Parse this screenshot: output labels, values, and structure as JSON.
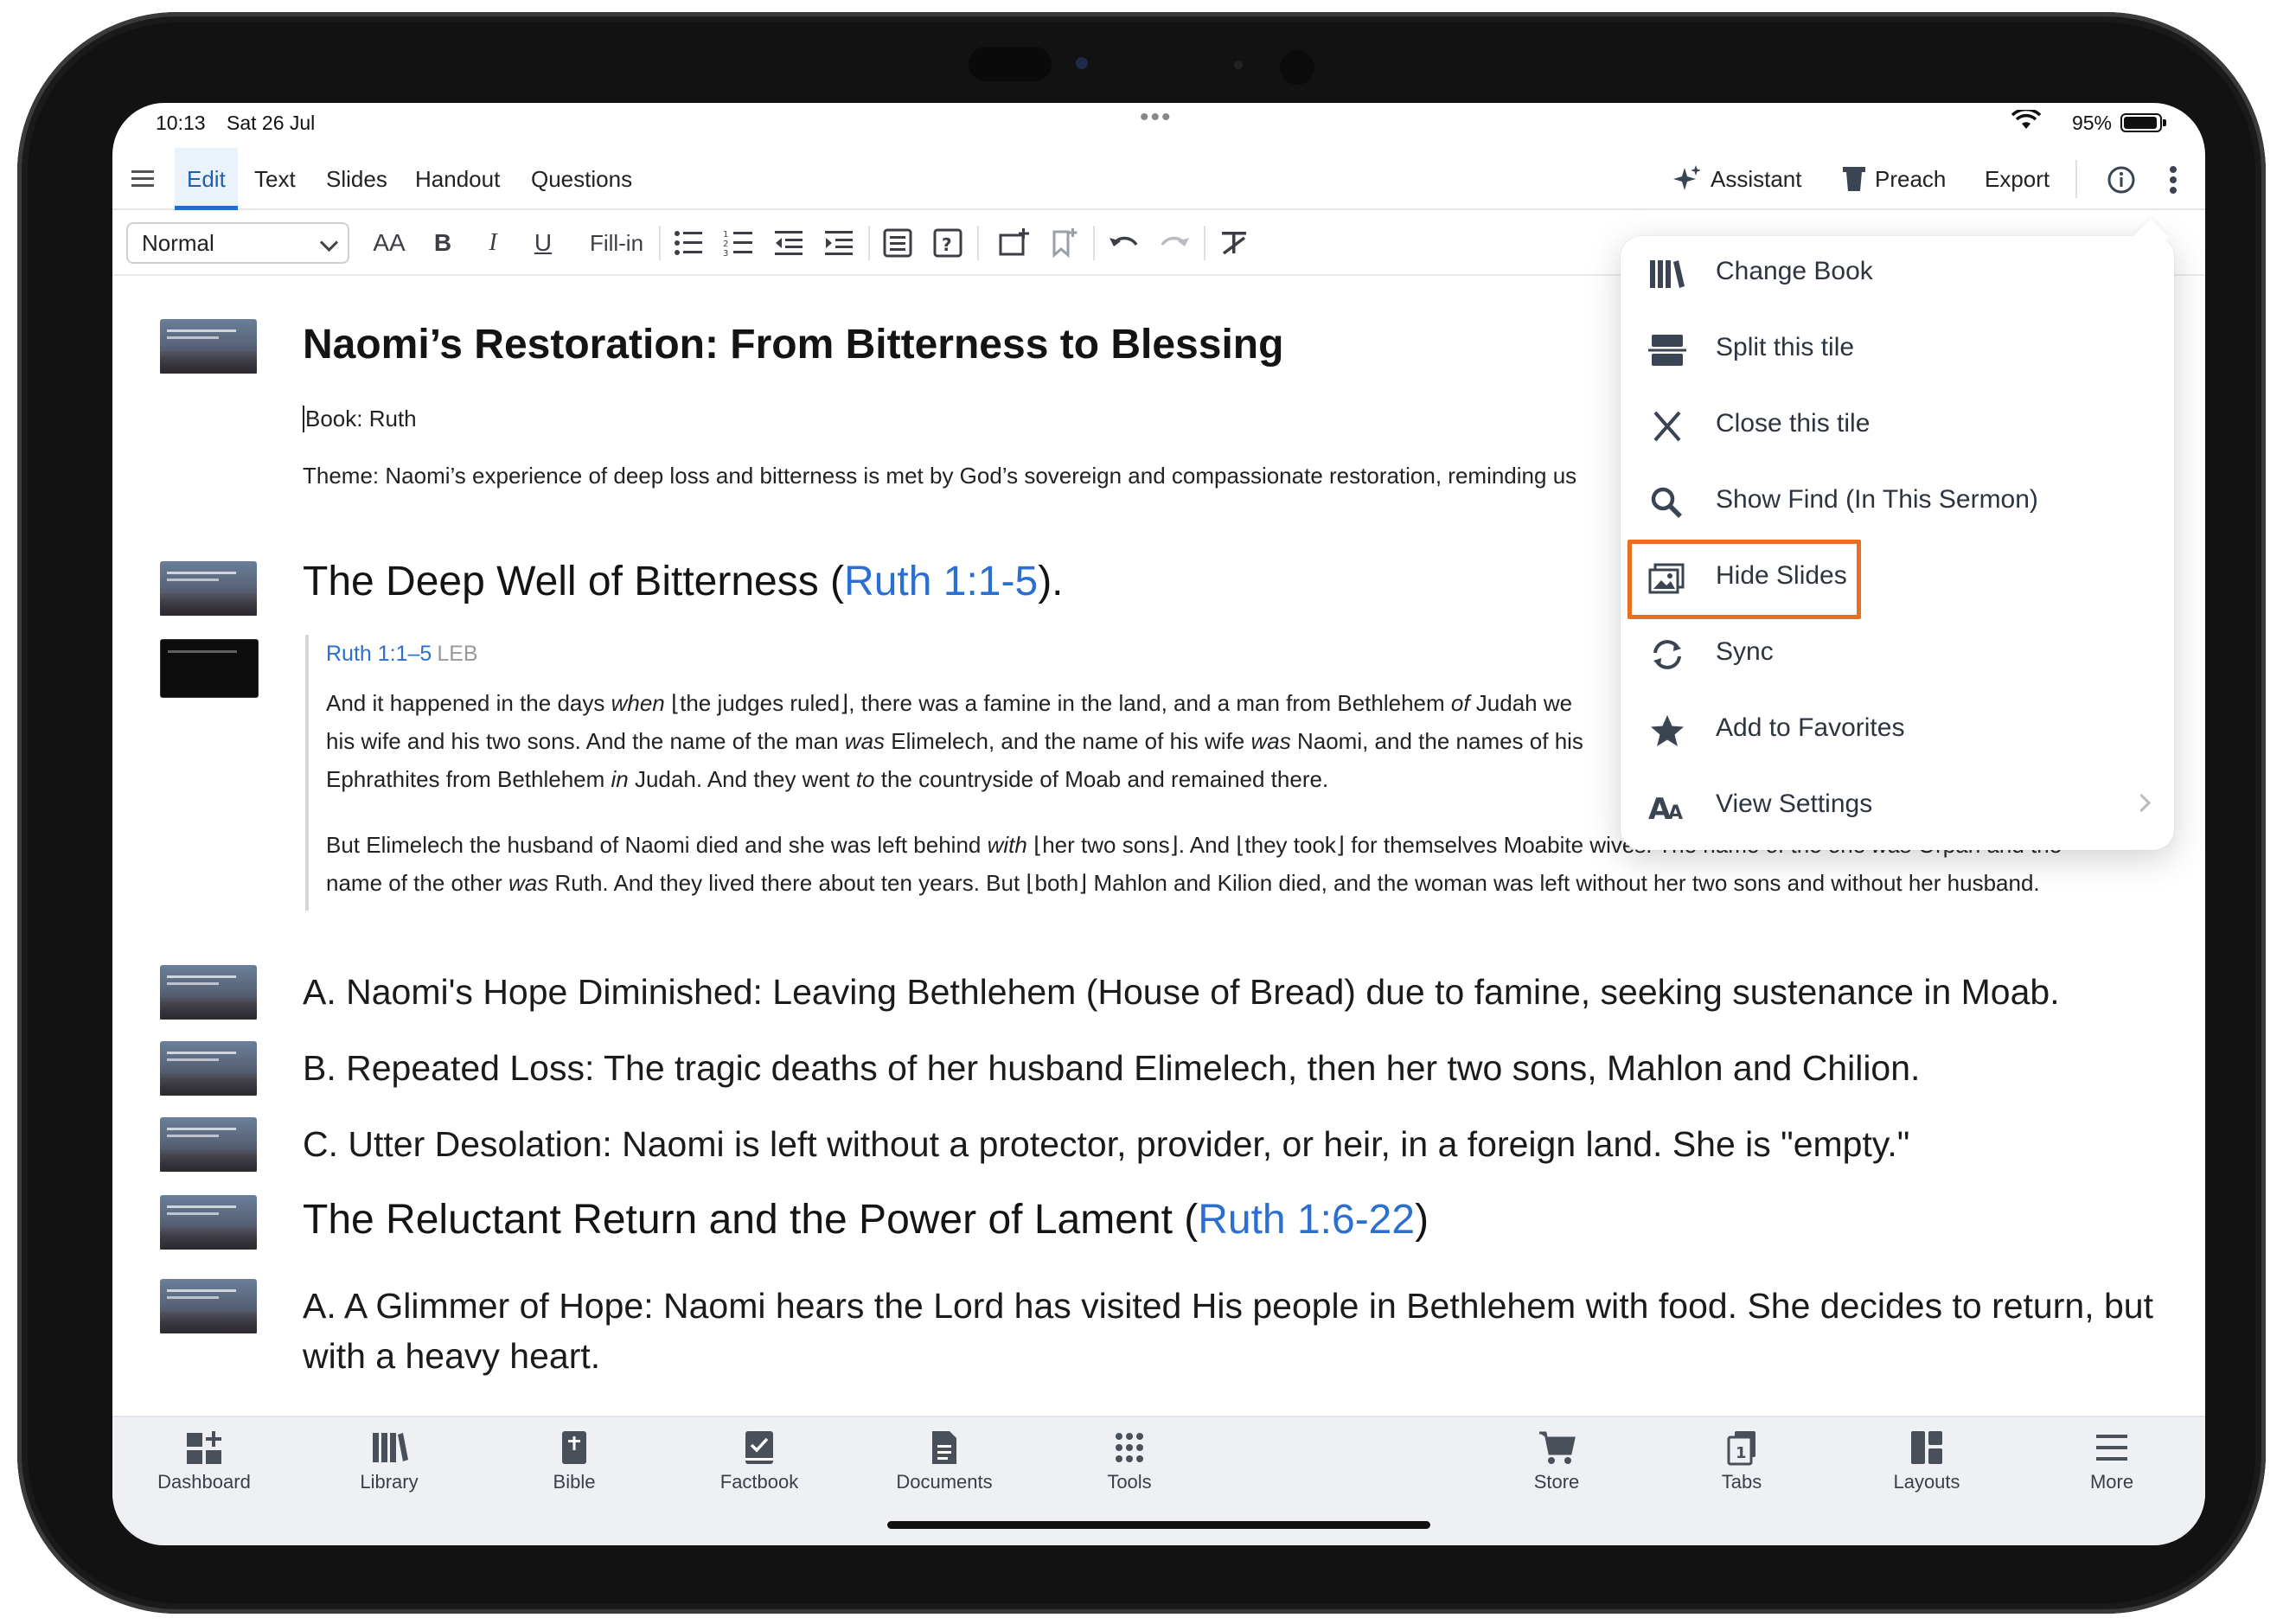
{
  "status": {
    "time": "10:13",
    "date": "Sat 26 Jul",
    "battery": "95%"
  },
  "menubar": {
    "tabs": [
      "Edit",
      "Text",
      "Slides",
      "Handout",
      "Questions"
    ],
    "right": {
      "assistant": "Assistant",
      "preach": "Preach",
      "export": "Export"
    }
  },
  "toolbar": {
    "style": "Normal",
    "font_size": "AA",
    "bold": "B",
    "italic": "I",
    "underline": "U",
    "fillin": "Fill-in"
  },
  "doc": {
    "title": "Naomi’s Restoration: From Bitterness to Blessing",
    "book": "Book: Ruth",
    "theme": "Theme: Naomi’s experience of deep loss and bitterness is met by God’s sovereign and compassionate restoration, reminding us",
    "h_well": "The Deep Well of Bitterness (",
    "h_well_ref": "Ruth 1:1-5",
    "h_well_end": ").",
    "quote_ref": "Ruth 1:1–5",
    "quote_ver": "LEB",
    "q1_a": "And it happened in the days ",
    "q1_when": "when",
    "q1_b": " ⌊the judges ruled⌋, there was a famine in the land, and a man from Bethlehem ",
    "q1_of": "of",
    "q1_c": " Judah we",
    "q2_a": "his wife and his two sons. And the name of the man ",
    "q2_was": "was",
    "q2_b": " Elimelech, and the name of his wife ",
    "q2_was2": "was",
    "q2_c": " Naomi, and the names of his",
    "q3_a": "Ephrathites from Bethlehem ",
    "q3_in": "in",
    "q3_b": " Judah. And they went ",
    "q3_to": "to",
    "q3_c": " the countryside of Moab and remained there.",
    "q4_a": "But Elimelech the husband of Naomi died and she was left behind ",
    "q4_with": "with",
    "q4_b": " ⌊her two sons⌋. And ⌊they took⌋ for themselves Moabite wives. The name of the one ",
    "q4_was": "was",
    "q4_c": " Orpah and the",
    "q5_a": "name of the other ",
    "q5_was": "was",
    "q5_b": " Ruth. And they lived there about ten years. But ⌊both⌋ Mahlon and Kilion died, and the woman was left without her two sons and without her husband.",
    "pA": "A. Naomi's Hope Diminished: Leaving Bethlehem (House of Bread) due to famine, seeking sustenance in Moab.",
    "pB": "B. Repeated Loss: The tragic deaths of her husband Elimelech, then her two sons, Mahlon and Chilion.",
    "pC": "C. Utter Desolation: Naomi is left without a protector, provider, or heir, in a foreign land. She is \"empty.\"",
    "h_return": "The Reluctant Return and the Power of Lament (",
    "h_return_ref": "Ruth 1:6-22",
    "h_return_end": ")",
    "pA2": "A. A Glimmer of Hope: Naomi hears the Lord has visited His people in Bethlehem with food. She decides to return, but with a heavy heart."
  },
  "popover": {
    "items": [
      "Change Book",
      "Split this tile",
      "Close this tile",
      "Show Find (In This Sermon)",
      "Hide Slides",
      "Sync",
      "Add to Favorites",
      "View Settings"
    ],
    "highlighted": "Hide Slides",
    "highlight_color": "#e8701f"
  },
  "bottomnav": [
    "Dashboard",
    "Library",
    "Bible",
    "Factbook",
    "Documents",
    "Tools",
    "Store",
    "Tabs",
    "Layouts",
    "More"
  ],
  "colors": {
    "link": "#2a6fd1",
    "active_tab": "#1f6ed4"
  }
}
